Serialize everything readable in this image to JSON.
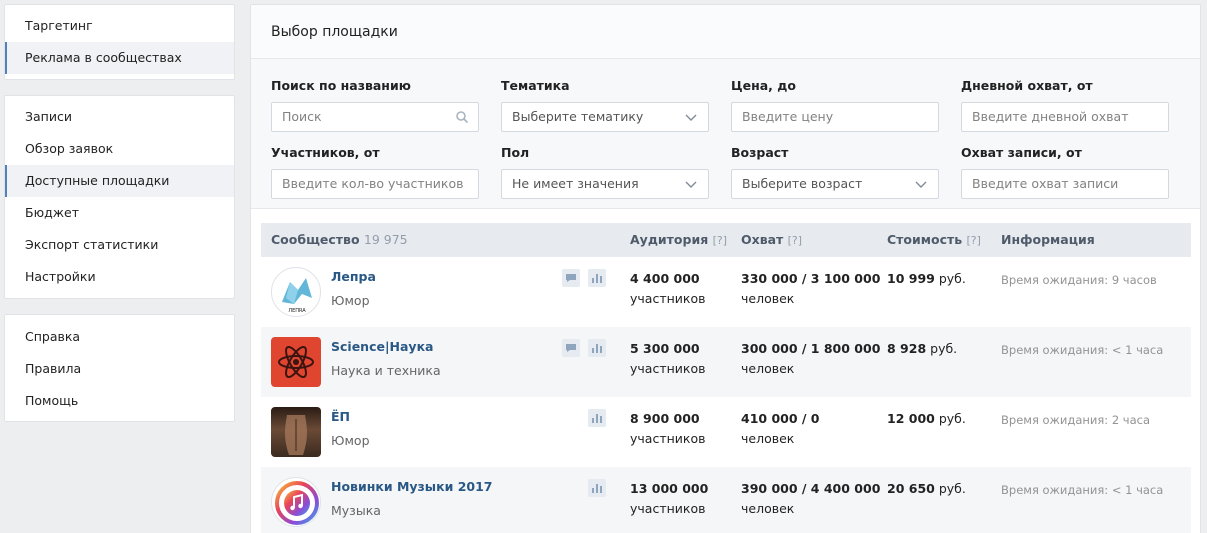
{
  "sidebar": {
    "top": [
      {
        "label": "Таргетинг",
        "active": false
      },
      {
        "label": "Реклама в сообществах",
        "active": true
      }
    ],
    "middle": [
      {
        "label": "Записи",
        "active": false
      },
      {
        "label": "Обзор заявок",
        "active": false
      },
      {
        "label": "Доступные площадки",
        "active": true
      },
      {
        "label": "Бюджет",
        "active": false
      },
      {
        "label": "Экспорт статистики",
        "active": false
      },
      {
        "label": "Настройки",
        "active": false
      }
    ],
    "bottom": [
      {
        "label": "Справка",
        "active": false
      },
      {
        "label": "Правила",
        "active": false
      },
      {
        "label": "Помощь",
        "active": false
      }
    ]
  },
  "main": {
    "title": "Выбор площадки"
  },
  "filters": {
    "search_name": {
      "label": "Поиск по названию",
      "placeholder": "Поиск"
    },
    "topic": {
      "label": "Тематика",
      "value": "Выберите тематику"
    },
    "price": {
      "label": "Цена, до",
      "placeholder": "Введите цену"
    },
    "daily_reach": {
      "label": "Дневной охват, от",
      "placeholder": "Введите дневной охват"
    },
    "members": {
      "label": "Участников, от",
      "placeholder": "Введите кол-во участников"
    },
    "gender": {
      "label": "Пол",
      "value": "Не имеет значения"
    },
    "age": {
      "label": "Возраст",
      "value": "Выберите возраст"
    },
    "post_reach": {
      "label": "Охват записи, от",
      "placeholder": "Введите охват записи"
    }
  },
  "table": {
    "headers": {
      "community": "Сообщество",
      "community_count": "19 975",
      "audience": "Аудитория",
      "reach": "Охват",
      "cost": "Стоимость",
      "info": "Информация",
      "help_mark": "[?]"
    },
    "rows": [
      {
        "name": "Лепра",
        "topic": "Юмор",
        "audience": "4 400 000",
        "audience_unit": "участников",
        "reach": "330 000 / 3 100 000",
        "reach_unit": "человек",
        "cost": "10 999",
        "currency": "руб.",
        "info": "Время ожидания: 9 часов",
        "has_comment_icon": true,
        "avatar_text": "ЛЕПRA"
      },
      {
        "name": "Science|Наука",
        "topic": "Наука и техника",
        "audience": "5 300 000",
        "audience_unit": "участников",
        "reach": "300 000 / 1 800 000",
        "reach_unit": "человек",
        "cost": "8 928",
        "currency": "руб.",
        "info": "Время ожидания: < 1 часа",
        "has_comment_icon": true
      },
      {
        "name": "ЁП",
        "topic": "Юмор",
        "audience": "8 900 000",
        "audience_unit": "участников",
        "reach": "410 000 / 0",
        "reach_unit": "человек",
        "cost": "12 000",
        "currency": "руб.",
        "info": "Время ожидания: 2 часа",
        "has_comment_icon": false
      },
      {
        "name": "Новинки Музыки 2017",
        "topic": "Музыка",
        "audience": "13 000 000",
        "audience_unit": "участников",
        "reach": "390 000 / 4 400 000",
        "reach_unit": "человек",
        "cost": "20 650",
        "currency": "руб.",
        "info": "Время ожидания: < 1 часа",
        "has_comment_icon": false
      }
    ]
  },
  "colors": {
    "accent": "#5181b8",
    "link": "#2a5885",
    "header_bg": "#e7ebf0"
  }
}
